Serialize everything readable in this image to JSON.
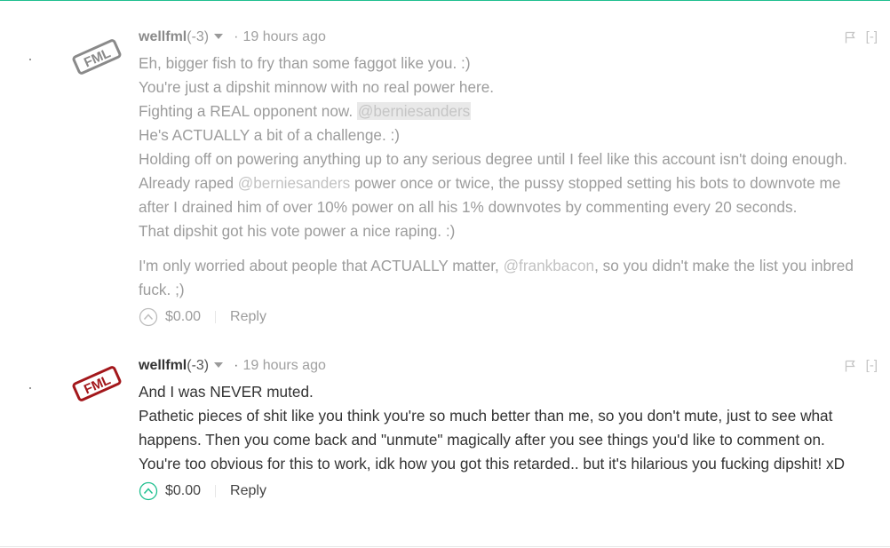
{
  "accent_color": "#1fbf8f",
  "comments": [
    {
      "author": "wellfml",
      "reputation": "(-3)",
      "separator": "·",
      "time": "19 hours ago",
      "collapse_label": "[-]",
      "avatar_text": "FML",
      "avatar_color": "#8a8a8a",
      "vote_icon": "upvote-chevron-icon",
      "payout": "$0.00",
      "reply_label": "Reply",
      "lines": {
        "l1": "Eh, bigger fish to fry than some faggot like you. :)",
        "l2": "You're just a dipshit minnow with no real power here.",
        "l3_before": "Fighting a REAL opponent now. ",
        "l3_mention": "@berniesanders",
        "l4": "He's ACTUALLY a bit of a challenge. :)",
        "l5": "Holding off on powering anything up to any serious degree until I feel like this account isn't doing enough.",
        "l6_before": "Already raped ",
        "l6_mention": "@berniesanders",
        "l6_after": " power once or twice, the pussy stopped setting his bots to downvote me",
        "l7": "after I drained him of over 10% power on all his 1% downvotes by commenting every 20 seconds.",
        "l8": "That dipshit got his vote power a nice raping. :)",
        "p2_before": "I'm only worried about people that ACTUALLY matter, ",
        "p2_mention": "@frankbacon",
        "p2_after_line1": ", so you didn't make the list you inbred",
        "p2_line2": "fuck. ;)"
      }
    },
    {
      "author": "wellfml",
      "reputation": "(-3)",
      "separator": "·",
      "time": "19 hours ago",
      "collapse_label": "[-]",
      "avatar_text": "FML",
      "avatar_color": "#a3171b",
      "vote_icon": "upvote-chevron-icon",
      "payout": "$0.00",
      "reply_label": "Reply",
      "lines": {
        "l1": "And I was NEVER muted.",
        "l2": "Pathetic pieces of shit like you think you're so much better than me, so you don't mute, just to see what",
        "l3": "happens. Then you come back and \"unmute\" magically after you see things you'd like to comment on.",
        "l4": "You're too obvious for this to work, idk how you got this retarded.. but it's hilarious you fucking dipshit! xD"
      }
    }
  ]
}
